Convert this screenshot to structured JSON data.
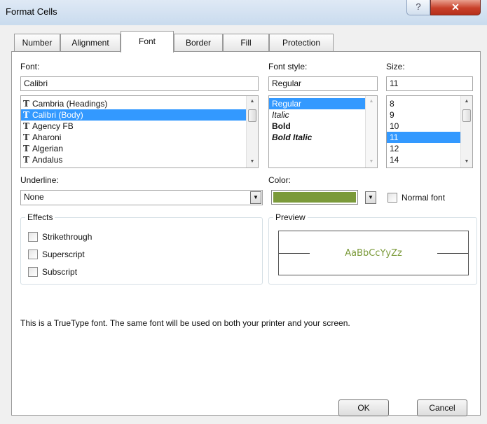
{
  "window": {
    "title": "Format Cells",
    "help_glyph": "?",
    "close_glyph": "✕"
  },
  "tabs": [
    {
      "label": "Number"
    },
    {
      "label": "Alignment"
    },
    {
      "label": "Font",
      "active": true
    },
    {
      "label": "Border"
    },
    {
      "label": "Fill"
    },
    {
      "label": "Protection"
    }
  ],
  "font": {
    "label": "Font:",
    "value": "Calibri",
    "items": [
      "Cambria (Headings)",
      "Calibri (Body)",
      "Agency FB",
      "Aharoni",
      "Algerian",
      "Andalus"
    ],
    "selected": "Calibri (Body)",
    "icon": "truetype-icon",
    "icon_glyph": "T"
  },
  "font_style": {
    "label": "Font style:",
    "value": "Regular",
    "items": [
      "Regular",
      "Italic",
      "Bold",
      "Bold Italic"
    ],
    "selected": "Regular"
  },
  "size": {
    "label": "Size:",
    "value": "11",
    "items": [
      "8",
      "9",
      "10",
      "11",
      "12",
      "14"
    ],
    "selected": "11"
  },
  "underline": {
    "label": "Underline:",
    "value": "None"
  },
  "color": {
    "label": "Color:",
    "value_hex": "#7b9a3a"
  },
  "normal_font": {
    "label": "Normal font",
    "checked": false
  },
  "effects": {
    "title": "Effects",
    "strikethrough": {
      "label": "Strikethrough",
      "checked": false
    },
    "superscript": {
      "label": "Superscript",
      "checked": false
    },
    "subscript": {
      "label": "Subscript",
      "checked": false
    }
  },
  "preview": {
    "title": "Preview",
    "sample": "AaBbCcYyZz",
    "color_hex": "#7b9a3a"
  },
  "info_text": "This is a TrueType font.  The same font will be used on both your printer and your screen.",
  "buttons": {
    "ok": "OK",
    "cancel": "Cancel"
  },
  "colors": {
    "selection": "#3399ff",
    "panel_bg": "#ffffff",
    "dialog_bg": "#f0f0f0"
  }
}
